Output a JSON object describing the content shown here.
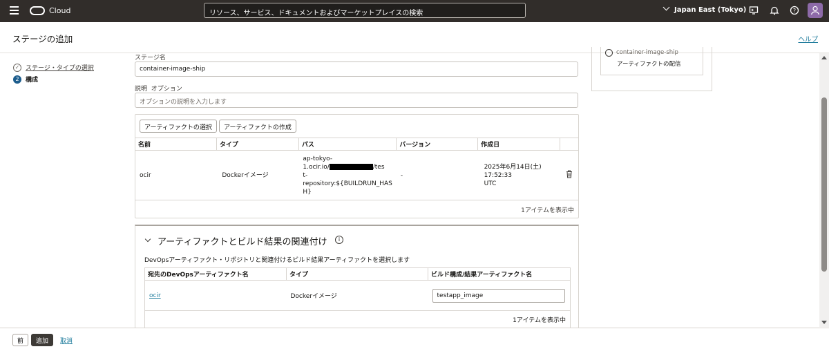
{
  "topbar": {
    "brand": "Cloud",
    "search_placeholder": "リソース、サービス、ドキュメントおよびマーケットプレイスの検索",
    "region": "Japan East (Tokyo)"
  },
  "header": {
    "title": "ステージの追加",
    "help": "ヘルプ"
  },
  "steps": [
    {
      "num": "✓",
      "label": "ステージ・タイプの選択"
    },
    {
      "num": "2",
      "label": "構成"
    }
  ],
  "form": {
    "stage_name_label": "ステージ名",
    "stage_name_value": "container-image-ship",
    "desc_label": "説明",
    "desc_optional": "オプション",
    "desc_placeholder": "オプションの説明を入力します"
  },
  "artifacts": {
    "select_button": "アーティファクトの選択",
    "create_button": "アーティファクトの作成",
    "columns": [
      "名前",
      "タイプ",
      "パス",
      "バージョン",
      "作成日"
    ],
    "row": {
      "name": "ocir",
      "type": "Dockerイメージ",
      "path_line1": "ap-tokyo-",
      "path_line2a": "1.ocir.io/",
      "path_line2b": "/tes",
      "path_line3": "t-",
      "path_line4": "repository:${BUILDRUN_HAS",
      "path_line5": "H}",
      "version": "-",
      "created_line1": "2025年6月14日(土) 17:52:33",
      "created_line2": "UTC"
    },
    "count": "1アイテムを表示中"
  },
  "association": {
    "title": "アーティファクトとビルド結果の関連付け",
    "description": "DevOpsアーティファクト・リポジトリと関連付けるビルド結果アーティファクトを選択します",
    "columns": [
      "宛先のDevOpsアーティファクト名",
      "タイプ",
      "ビルド構成/結果アーティファクト名"
    ],
    "row": {
      "name": "ocir",
      "type": "Dockerイメージ",
      "value": "testapp_image"
    },
    "count": "1アイテムを表示中"
  },
  "sidebar": {
    "item_cut": "container-image-ship",
    "item_text": "アーティファクトの配信"
  },
  "footer": {
    "prev": "前",
    "add": "追加",
    "cancel": "取消"
  }
}
